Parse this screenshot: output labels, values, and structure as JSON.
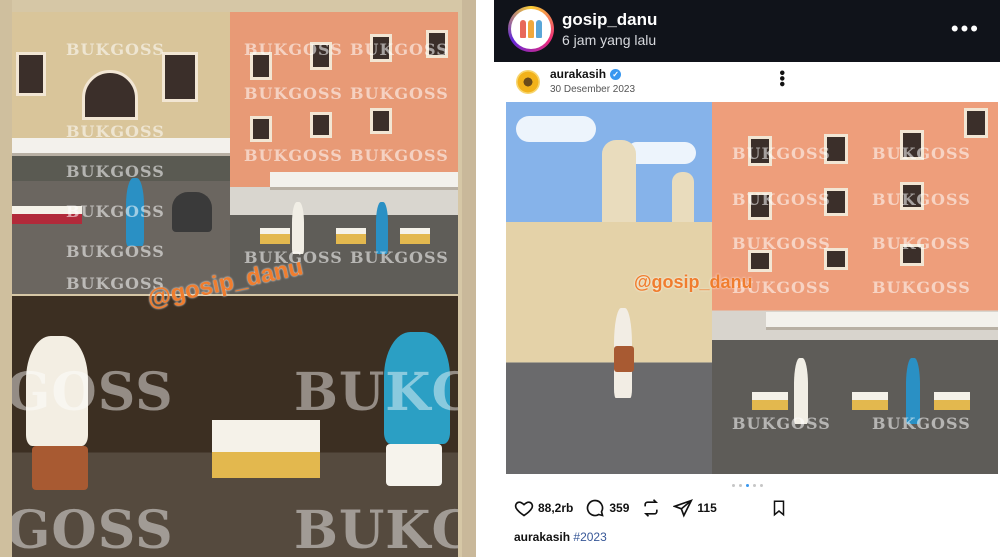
{
  "collage": {
    "watermark": "BUKGOSS",
    "watermark_big": "GOSS",
    "watermark_big2": "BUKG",
    "tag": "@gosip_danu"
  },
  "top_bar": {
    "username": "gosip_danu",
    "time": "6 jam yang lalu",
    "more_icon": "more-horizontal-icon"
  },
  "post": {
    "username": "aurakasih",
    "date": "30 Desember 2023",
    "verified": true,
    "image_tag": "@gosip_danu",
    "watermark": "BUKGOSS",
    "carousel": {
      "count": 5,
      "active": 3
    },
    "likes": "88,2rb",
    "comments": "359",
    "shares": "115",
    "caption_user": "aurakasih",
    "caption_tag": "#2023"
  },
  "colors": {
    "accent_orange": "#f07d2e",
    "verified_blue": "#3897f0",
    "header_dark": "#10131a"
  }
}
